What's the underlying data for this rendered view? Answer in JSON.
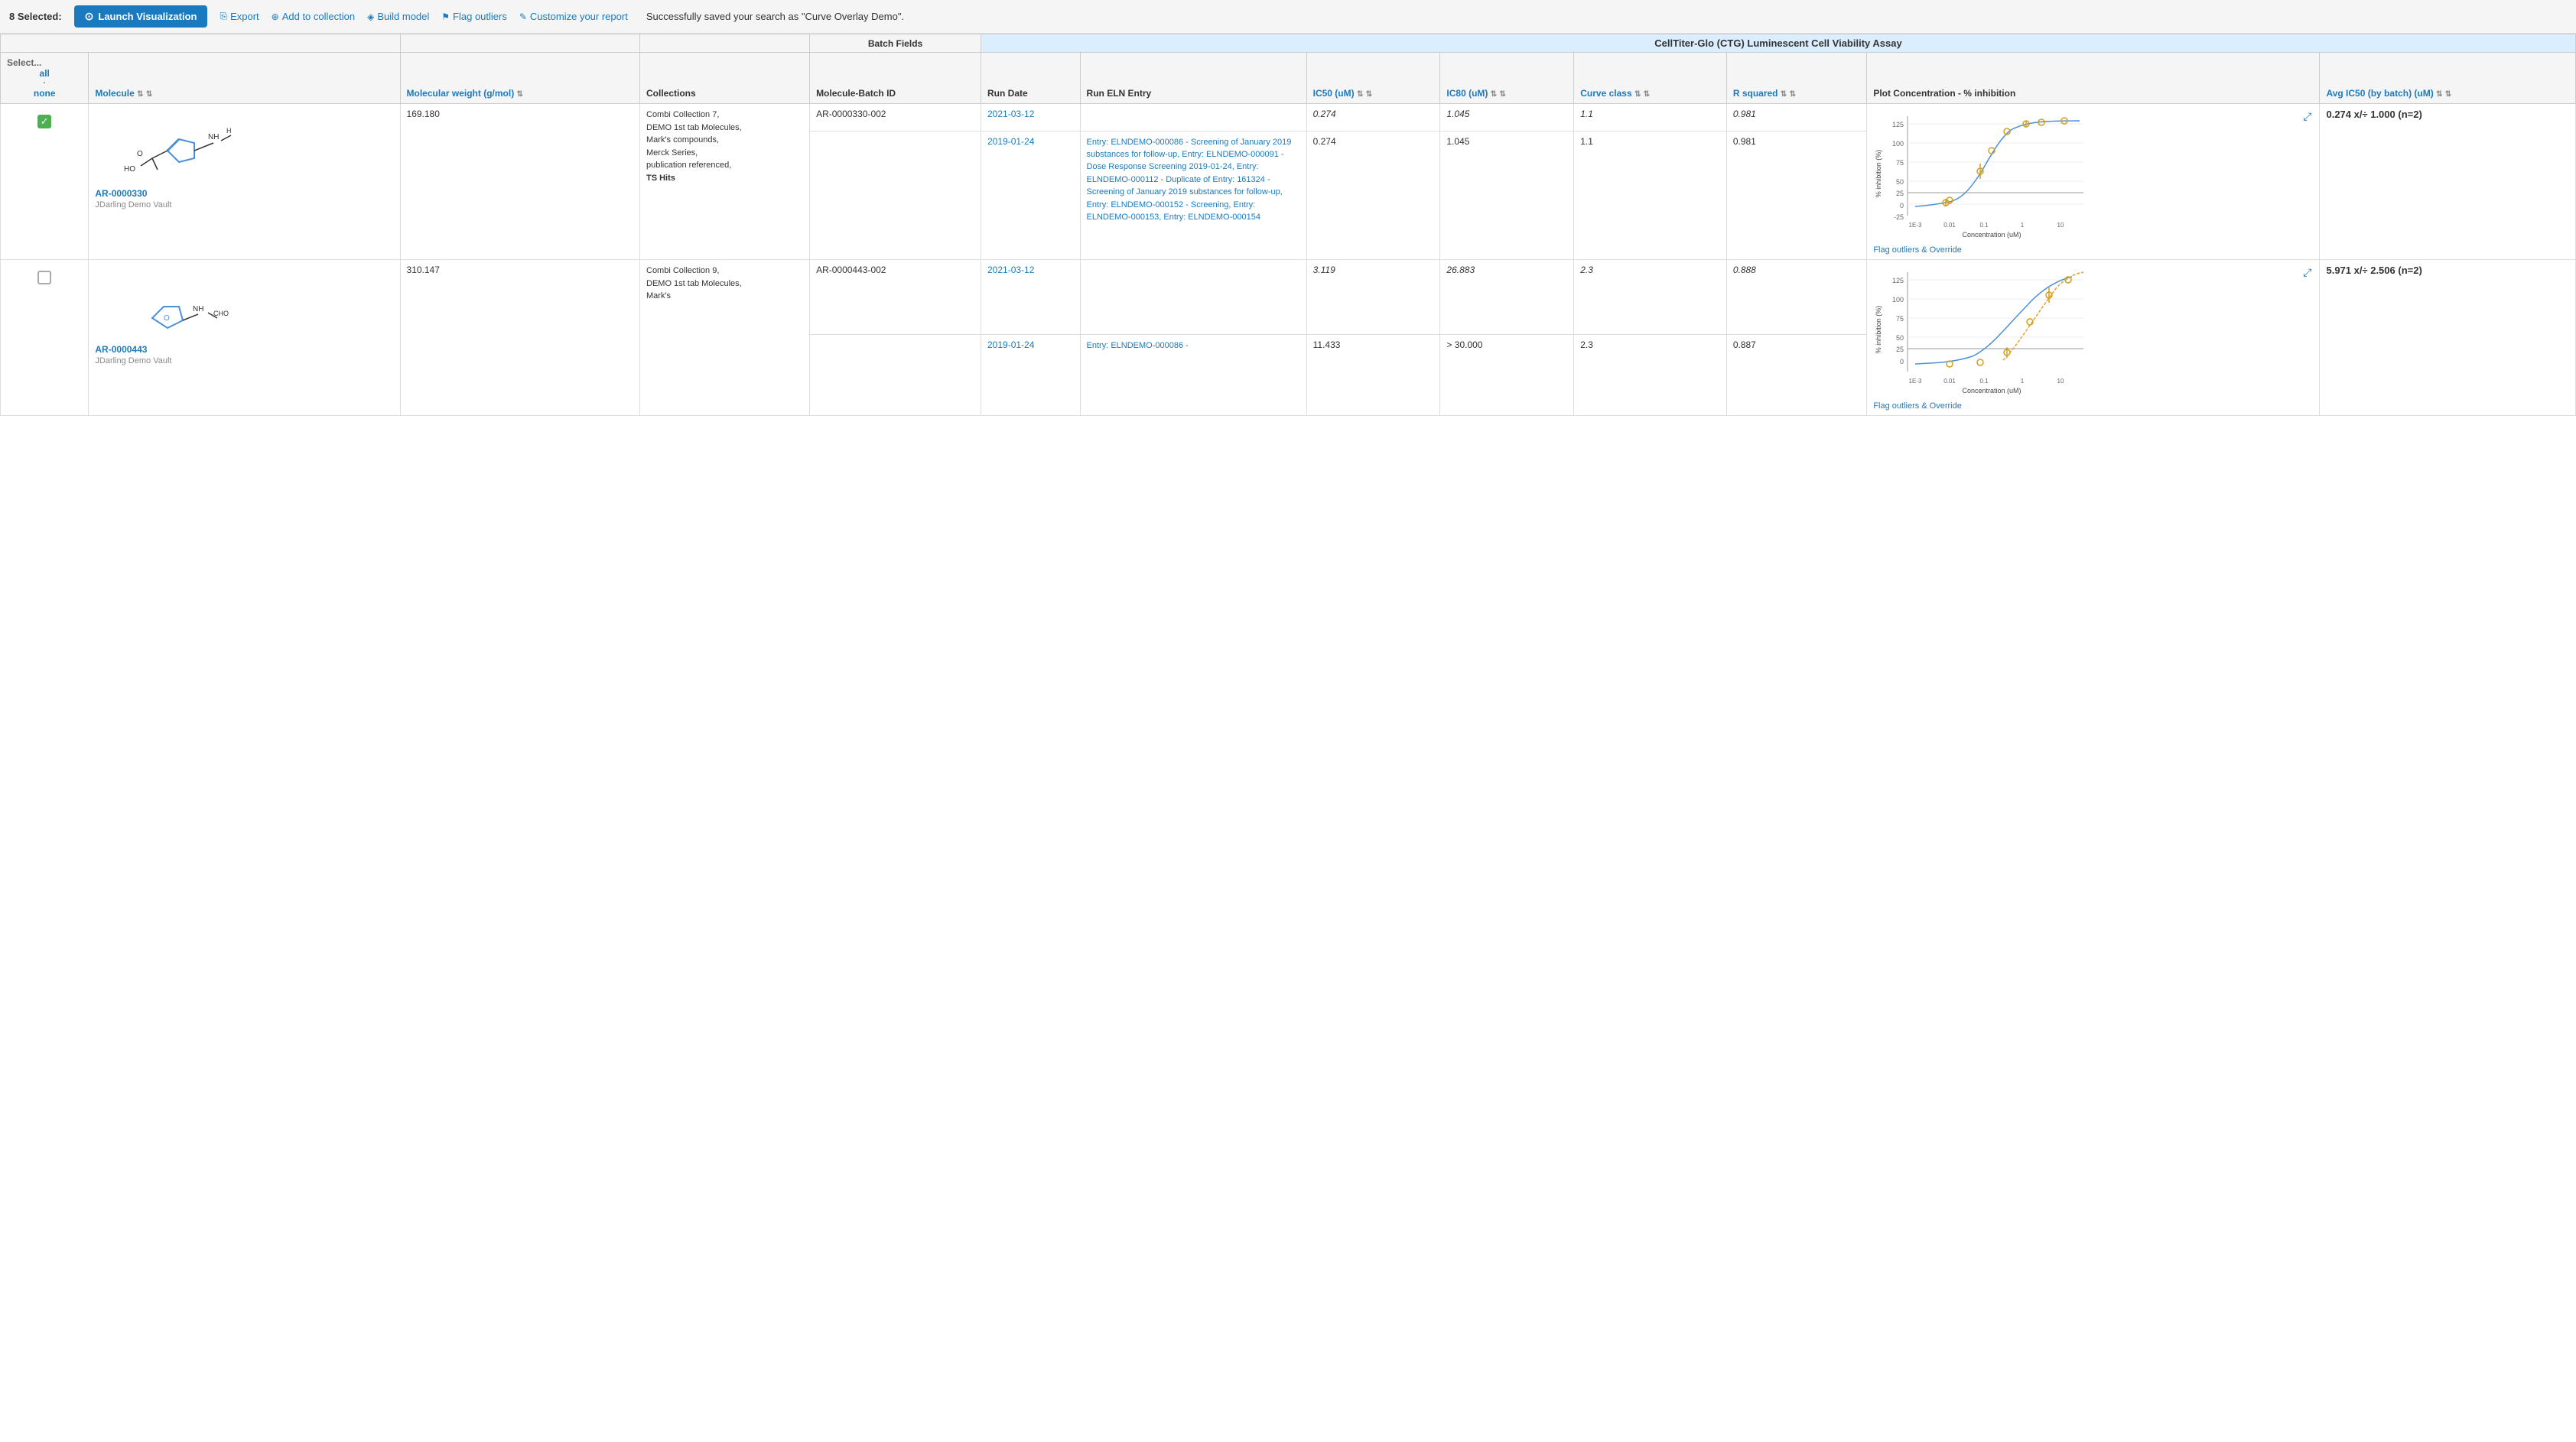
{
  "toolbar": {
    "selected_count": "8 Selected:",
    "launch_btn": "Launch Visualization",
    "export_btn": "Export",
    "add_collection_btn": "Add to collection",
    "build_model_btn": "Build model",
    "flag_outliers_btn": "Flag outliers",
    "customize_report_btn": "Customize your report",
    "success_msg": "Successfully saved your search as \"Curve Overlay Demo\"."
  },
  "table": {
    "col_select_label": "Select...",
    "col_select_all": "all",
    "col_select_dot": "·",
    "col_select_none": "none",
    "col_molecule": "Molecule",
    "col_mw": "Molecular weight (g/mol)",
    "col_collections": "Collections",
    "col_batch_id": "Molecule-Batch ID",
    "col_run_date": "Run Date",
    "col_eln": "Run ELN Entry",
    "col_ic50": "IC50 (uM)",
    "col_ic80": "IC80 (uM)",
    "col_curve": "Curve class",
    "col_rsq": "R squared",
    "col_plot": "Plot Concentration - % inhibition",
    "col_avgic50": "Avg IC50 (by batch) (uM)",
    "assay_name": "CellTiter-Glo (CTG) Luminescent Cell Viability Assay"
  },
  "rows": [
    {
      "molecule_id": "AR-0000330",
      "molecule_vault": "JDarling Demo Vault",
      "mol_weight": "169.180",
      "collections": [
        "Combi Collection 7,",
        "DEMO 1st tab Molecules,",
        "Mark's compounds,",
        "Merck Series,",
        "publication referenced,",
        "TS Hits"
      ],
      "run1": {
        "batch_id": "AR-0000330-002",
        "run_date": "2021-03-12",
        "eln_entry": "",
        "ic50": "0.274",
        "ic80": "1.045",
        "curve_class": "1.1",
        "r_squared": "0.981"
      },
      "run2": {
        "batch_id": "",
        "run_date": "2019-01-24",
        "eln_entry": "Entry: ELNDEMO-000086 - Screening of January 2019 substances for follow-up, Entry: ELNDEMO-000091 - Dose Response Screening 2019-01-24, Entry: ELNDEMO-000112 - Duplicate of Entry: 161324 - Screening of January 2019 substances for follow-up, Entry: ELNDEMO-000152 - Screening, Entry: ELNDEMO-000153, Entry: ELNDEMO-000154",
        "ic50": "0.274",
        "ic80": "1.045",
        "curve_class": "1.1",
        "r_squared": "0.981"
      },
      "avg_ic50": "0.274 x/÷ 1.000 (n=2)"
    },
    {
      "molecule_id": "AR-0000443",
      "molecule_vault": "JDarling Demo Vault",
      "mol_weight": "310.147",
      "collections": [
        "Combi Collection 9,",
        "DEMO 1st tab Molecules,",
        "Mark's"
      ],
      "run1": {
        "batch_id": "AR-0000443-002",
        "run_date": "2021-03-12",
        "eln_entry": "",
        "ic50": "3.119",
        "ic80": "26.883",
        "curve_class": "2.3",
        "r_squared": "0.888"
      },
      "run2": {
        "batch_id": "",
        "run_date": "2019-01-24",
        "eln_entry": "Entry: ELNDEMO-000086 -",
        "ic50": "11.433",
        "ic80": "> 30.000",
        "curve_class": "2.3",
        "r_squared": "0.887"
      },
      "avg_ic50": "5.971 x/÷ 2.506 (n=2)"
    }
  ],
  "plot1": {
    "y_labels": [
      "125",
      "100",
      "75",
      "50",
      "25",
      "0",
      "-25"
    ],
    "x_labels": [
      "1E-3",
      "0.01",
      "0.1",
      "1",
      "10"
    ],
    "x_axis_label": "Concentration (uM)",
    "y_axis_label": "% inhibition (%)",
    "flag_link": "Flag outliers & Override"
  },
  "plot2": {
    "y_labels": [
      "125",
      "100",
      "75",
      "50",
      "25",
      "0"
    ],
    "x_labels": [
      "1E-3",
      "0.01",
      "0.1",
      "1",
      "10"
    ],
    "x_axis_label": "Concentration (uM)",
    "y_axis_label": "% inhibition (%)",
    "flag_link": "Flag outliers & Override"
  }
}
